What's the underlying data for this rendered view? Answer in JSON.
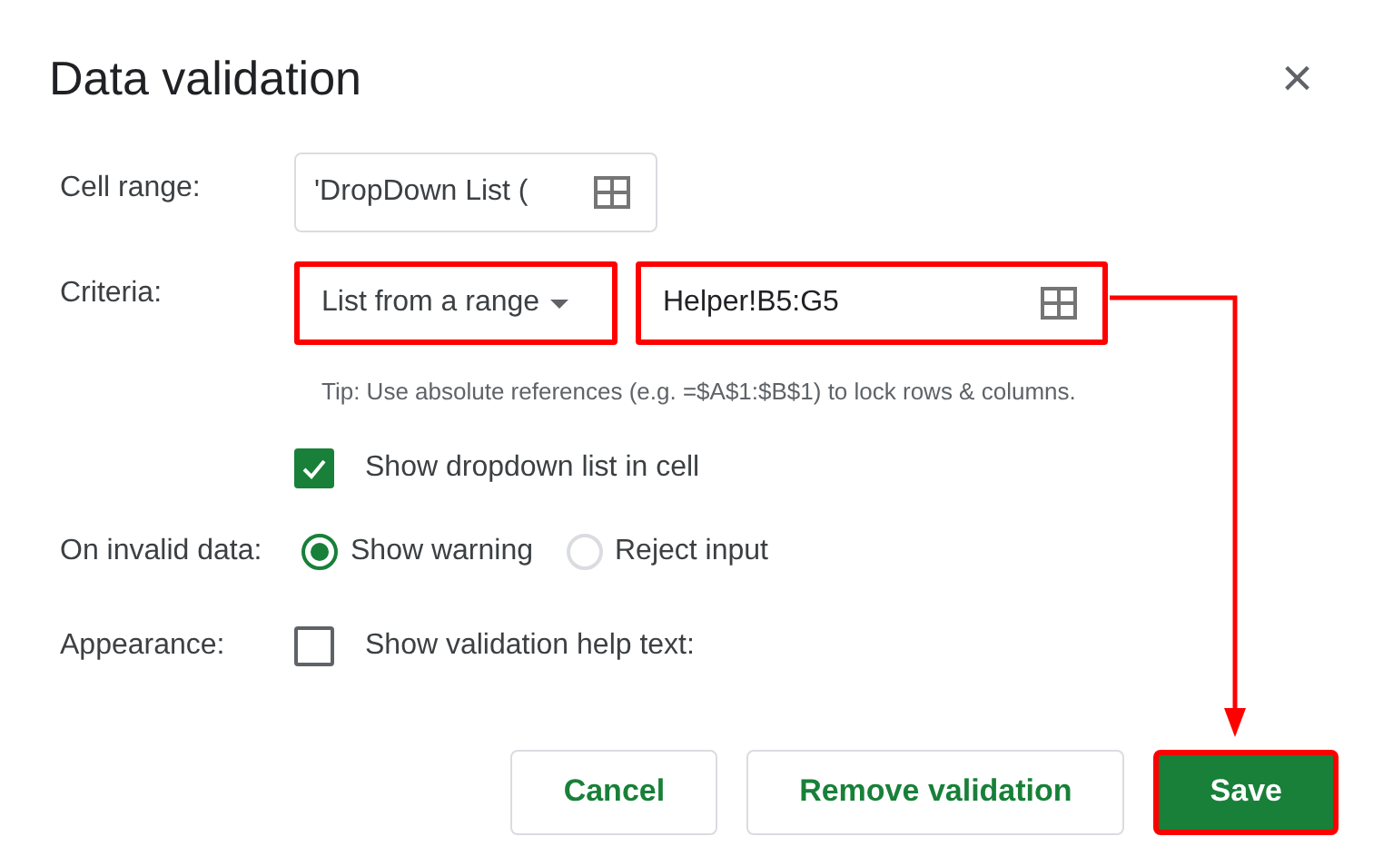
{
  "dialog": {
    "title": "Data validation",
    "close": "×"
  },
  "cell_range": {
    "label": "Cell range:",
    "value": "'DropDown List ("
  },
  "criteria": {
    "label": "Criteria:",
    "type": "List from a range",
    "type_highlighted": true,
    "value": "Helper!B5:G5",
    "value_highlighted": true,
    "tip": "Tip: Use absolute references (e.g. =$A$1:$B$1) to lock rows & columns."
  },
  "show_dropdown": {
    "label": "Show dropdown list in cell",
    "checked": true
  },
  "on_invalid": {
    "label": "On invalid data:",
    "options": [
      {
        "label": "Show warning",
        "selected": true
      },
      {
        "label": "Reject input",
        "selected": false
      }
    ]
  },
  "appearance": {
    "label": "Appearance:",
    "option": {
      "label": "Show validation help text:",
      "checked": false
    }
  },
  "buttons": [
    {
      "label": "Cancel",
      "kind": "secondary",
      "highlighted": false
    },
    {
      "label": "Remove validation",
      "kind": "secondary",
      "highlighted": false
    },
    {
      "label": "Save",
      "kind": "primary",
      "highlighted": true
    }
  ],
  "annotation": {
    "arrow": true
  }
}
